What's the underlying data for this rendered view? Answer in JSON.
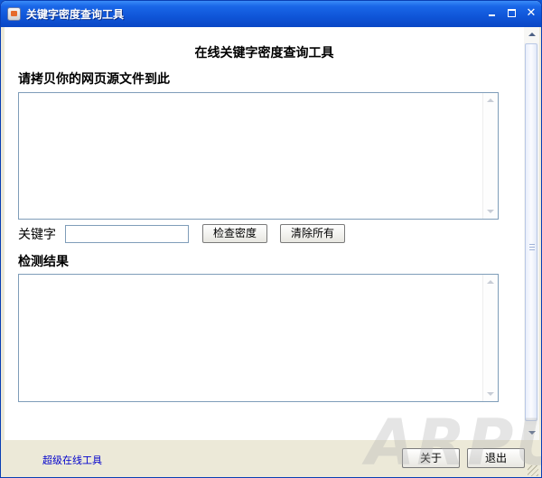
{
  "window": {
    "title": "关键字密度查询工具",
    "icon": "app-icon"
  },
  "main": {
    "heading": "在线关键字密度查询工具",
    "source_label": "请拷贝你的网页源文件到此",
    "source_value": "",
    "keyword_label": "关键字",
    "keyword_value": "",
    "check_button": "检查密度",
    "clear_button": "清除所有",
    "result_label": "检测结果",
    "result_value": ""
  },
  "footer": {
    "link_text": "超级在线工具",
    "about_button": "关于",
    "exit_button": "退出"
  },
  "watermark": "ARPUN",
  "colors": {
    "titlebar": "#0f55d8",
    "link": "#0000cc",
    "frame": "#ece9d8"
  }
}
